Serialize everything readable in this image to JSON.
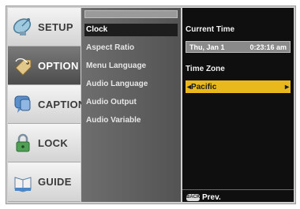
{
  "tabs": [
    {
      "label": "SETUP",
      "icon": "satellite-dish-icon",
      "active": false
    },
    {
      "label": "OPTION",
      "icon": "tag-icon",
      "active": true
    },
    {
      "label": "CAPTION",
      "icon": "speech-bubble-icon",
      "active": false
    },
    {
      "label": "LOCK",
      "icon": "padlock-icon",
      "active": false
    },
    {
      "label": "GUIDE",
      "icon": "book-icon",
      "active": false
    }
  ],
  "menu": {
    "items": [
      "Clock",
      "Aspect Ratio",
      "Menu Language",
      "Audio Language",
      "Audio Output",
      "Audio Variable"
    ],
    "selected": "Clock"
  },
  "detail": {
    "current_time_label": "Current Time",
    "date": "Thu, Jan 1",
    "time": "0:23:16 am",
    "time_zone_label": "Time Zone",
    "time_zone_value": "Pacific",
    "left_arrow": "◂",
    "right_arrow": "▸"
  },
  "footer": {
    "key_label": "BACK",
    "prev_label": "Prev."
  },
  "colors": {
    "highlight": "#e8b81c",
    "panel": "#0f0f0f",
    "menu": "#5f5f5f",
    "active_tab": "#5a5a5a"
  }
}
